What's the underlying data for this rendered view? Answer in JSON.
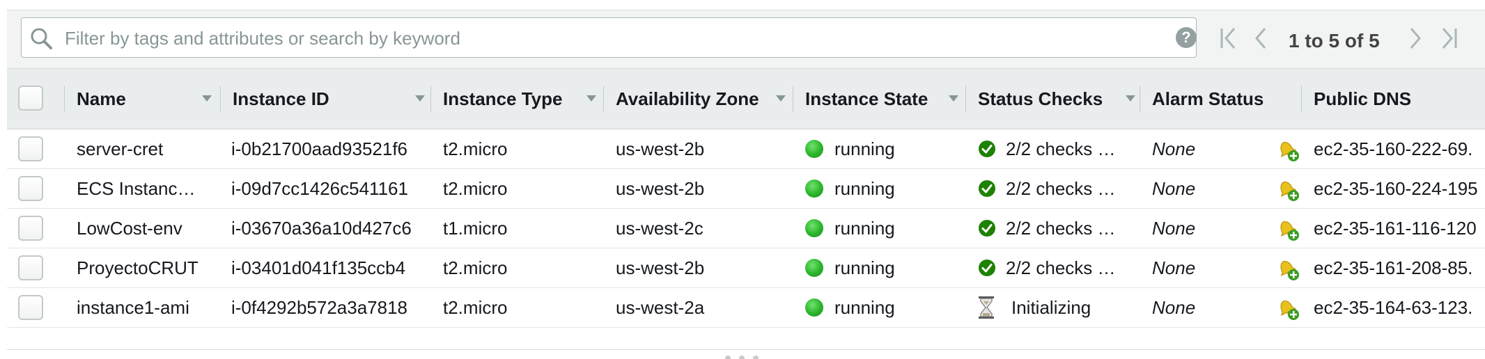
{
  "search": {
    "placeholder": "Filter by tags and attributes or search by keyword",
    "value": ""
  },
  "pagination": {
    "text": "1 to 5 of 5"
  },
  "columns": [
    {
      "label": "Name"
    },
    {
      "label": "Instance ID"
    },
    {
      "label": "Instance Type"
    },
    {
      "label": "Availability Zone"
    },
    {
      "label": "Instance State"
    },
    {
      "label": "Status Checks"
    },
    {
      "label": "Alarm Status"
    },
    {
      "label": "Public DNS"
    }
  ],
  "rows": [
    {
      "name": "server-cret",
      "instance_id": "i-0b21700aad93521f6",
      "type": "t2.micro",
      "az": "us-west-2b",
      "state": "running",
      "status": "2/2 checks …",
      "status_icon": "check-circle-icon",
      "alarm": "None",
      "dns": "ec2-35-160-222-69."
    },
    {
      "name": "ECS Instanc…",
      "instance_id": "i-09d7cc1426c541161",
      "type": "t2.micro",
      "az": "us-west-2b",
      "state": "running",
      "status": "2/2 checks …",
      "status_icon": "check-circle-icon",
      "alarm": "None",
      "dns": "ec2-35-160-224-195"
    },
    {
      "name": "LowCost-env",
      "instance_id": "i-03670a36a10d427c6",
      "type": "t1.micro",
      "az": "us-west-2c",
      "state": "running",
      "status": "2/2 checks …",
      "status_icon": "check-circle-icon",
      "alarm": "None",
      "dns": "ec2-35-161-116-120"
    },
    {
      "name": "ProyectoCRUT",
      "instance_id": "i-03401d041f135ccb4",
      "type": "t2.micro",
      "az": "us-west-2b",
      "state": "running",
      "status": "2/2 checks …",
      "status_icon": "check-circle-icon",
      "alarm": "None",
      "dns": "ec2-35-161-208-85."
    },
    {
      "name": "instance1-ami",
      "instance_id": "i-0f4292b572a3a7818",
      "type": "t2.micro",
      "az": "us-west-2a",
      "state": "running",
      "status": "Initializing",
      "status_icon": "hourglass-icon",
      "alarm": "None",
      "dns": "ec2-35-164-63-123."
    }
  ],
  "colors": {
    "running": "#2bb32b",
    "check": "#1d8102",
    "bell": "#e8c11c",
    "plus": "#3a9d23"
  }
}
